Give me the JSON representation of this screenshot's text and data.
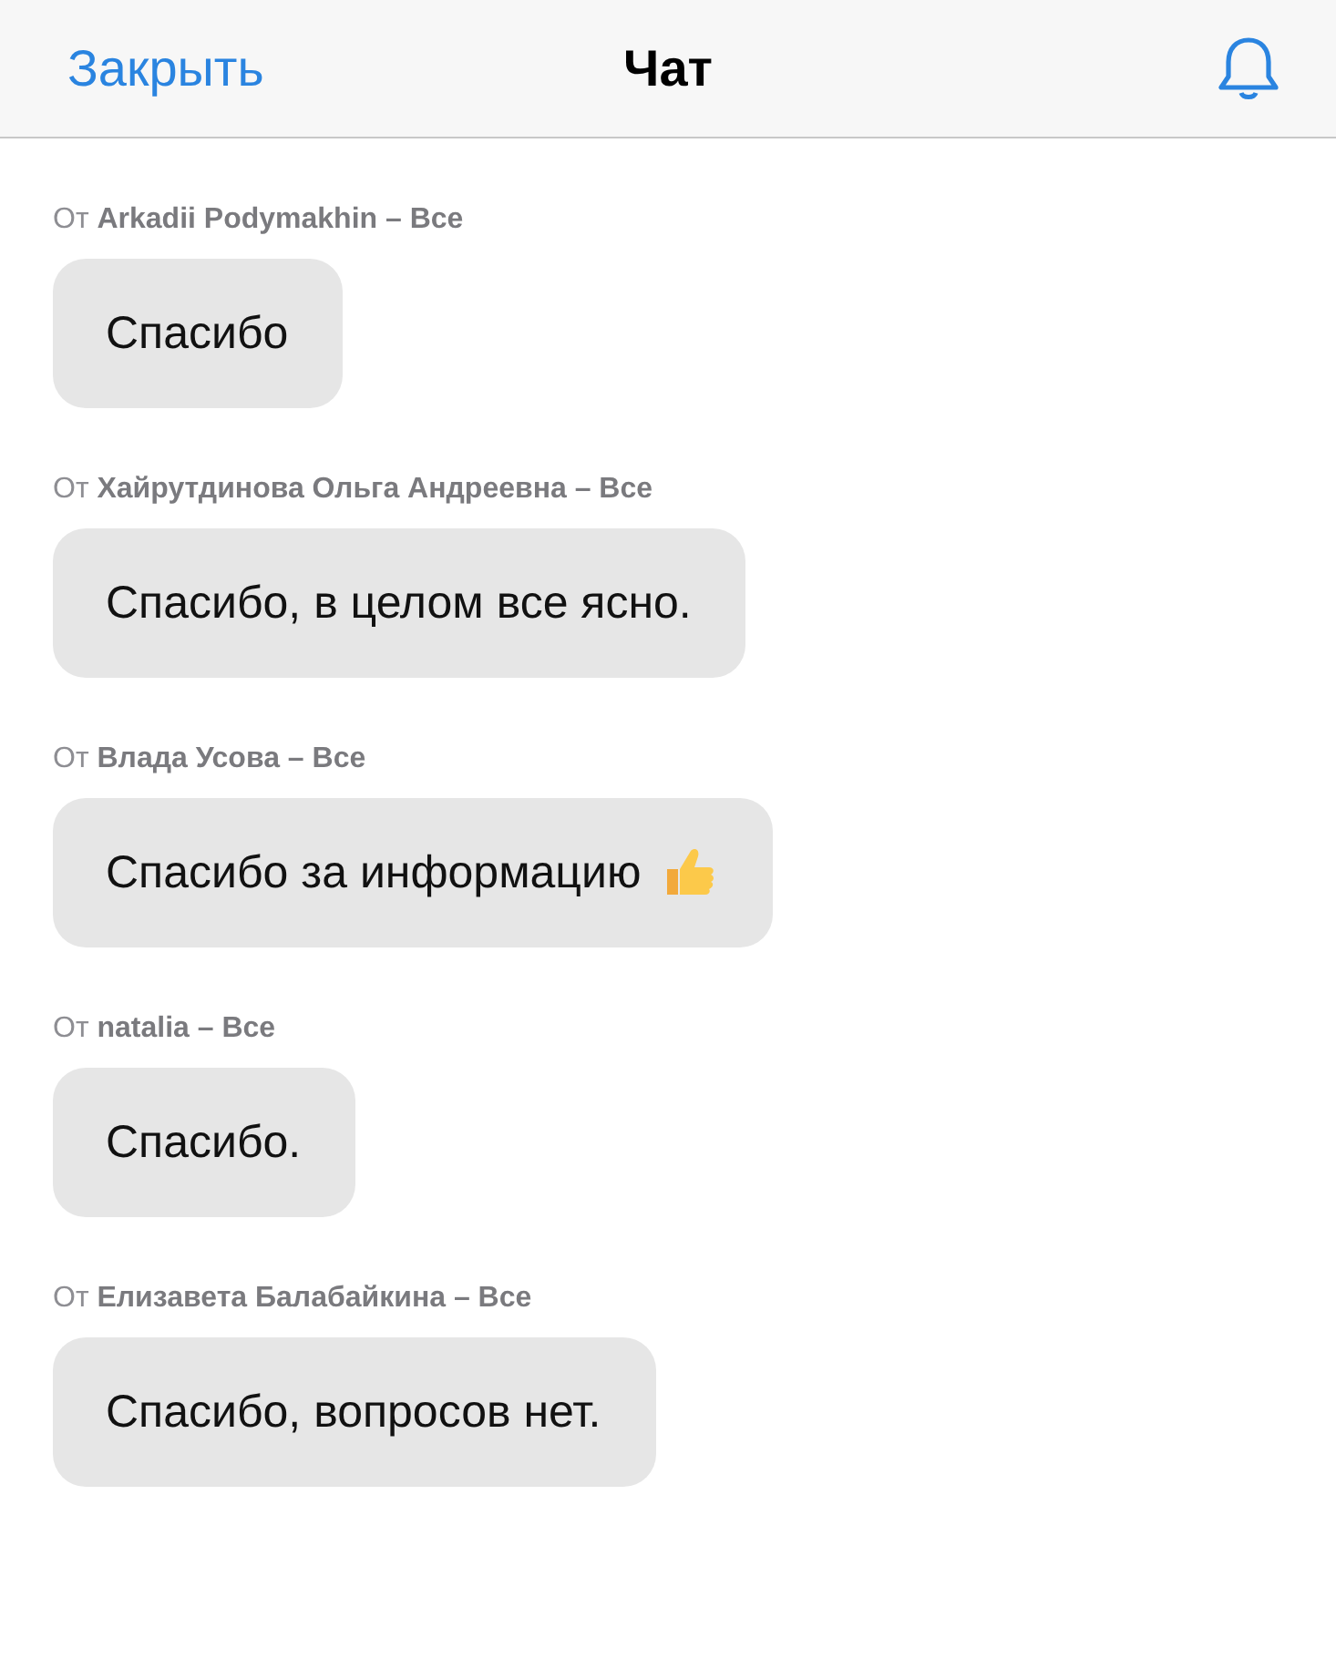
{
  "header": {
    "close_label": "Закрыть",
    "title": "Чат"
  },
  "messages": [
    {
      "kind": "plain",
      "meta": "От **Arkadii Podymakhin – Все**",
      "text": "Спасибо"
    },
    {
      "kind": "plain",
      "meta": "От **Хайрутдинова Ольга Андреевна – Все**",
      "text": "Спасибо, в целом все ясно."
    },
    {
      "kind": "thumbs",
      "meta": "От **Влада Усова – Все**",
      "text": "Спасибо за информацию"
    },
    {
      "kind": "plain",
      "meta": "От **natalia – Все**",
      "text": "Спасибо."
    },
    {
      "kind": "plain",
      "meta": "От **Елизавета Балабайкина – Все**",
      "text": "Спасибо, вопросов нет."
    }
  ]
}
